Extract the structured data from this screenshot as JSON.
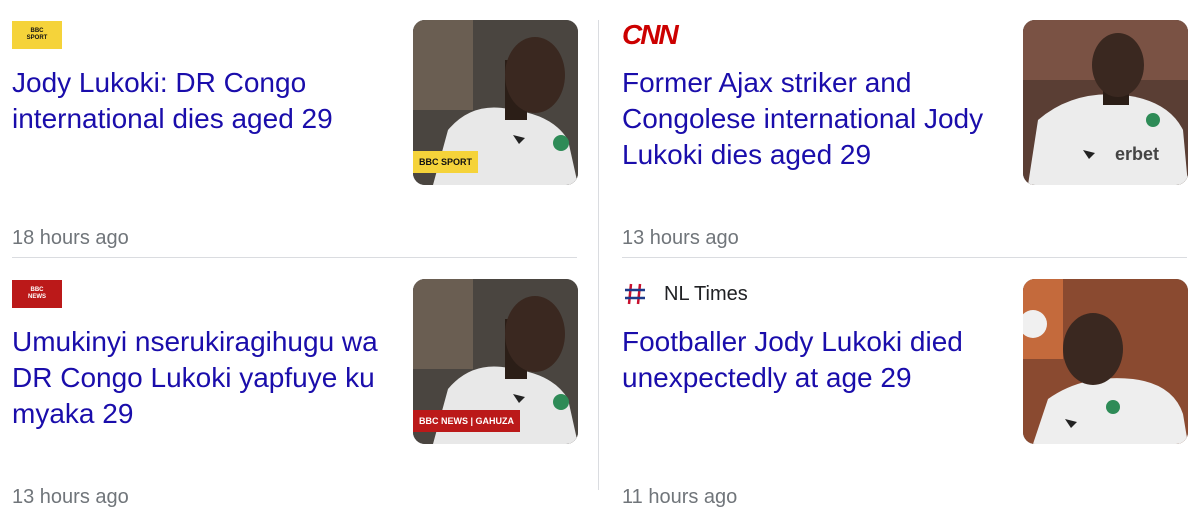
{
  "articles": [
    {
      "source_logo": {
        "top": "BBC",
        "bottom": "SPORT"
      },
      "headline": "Jody Lukoki: DR Congo international dies aged 29",
      "time": "18 hours ago",
      "thumb_badge": "BBC SPORT"
    },
    {
      "source_logo": {
        "text": "CNN"
      },
      "headline": "Former Ajax striker and Congolese international Jody Lukoki dies aged 29",
      "time": "13 hours ago",
      "shirt_text": "erbet"
    },
    {
      "source_logo": {
        "top": "BBC",
        "bottom": "NEWS"
      },
      "headline": "Umukinyi nserukiragihugu wa DR Congo Lukoki yapfuye ku myaka 29",
      "time": "13 hours ago",
      "thumb_badge": "BBC NEWS | GAHUZA"
    },
    {
      "source_name": "NL Times",
      "headline": "Footballer Jody Lukoki died unexpectedly at age 29",
      "time": "11 hours ago"
    }
  ],
  "colors": {
    "headline": "#1a0dab",
    "time": "#70757a",
    "divider": "#dadce0",
    "bbc_sport": "#f5d33a",
    "bbc_news": "#bb1919",
    "cnn": "#cc0000"
  },
  "icons": [
    "bbc-sport-logo",
    "cnn-logo",
    "bbc-news-logo",
    "nl-times-hash-icon"
  ]
}
